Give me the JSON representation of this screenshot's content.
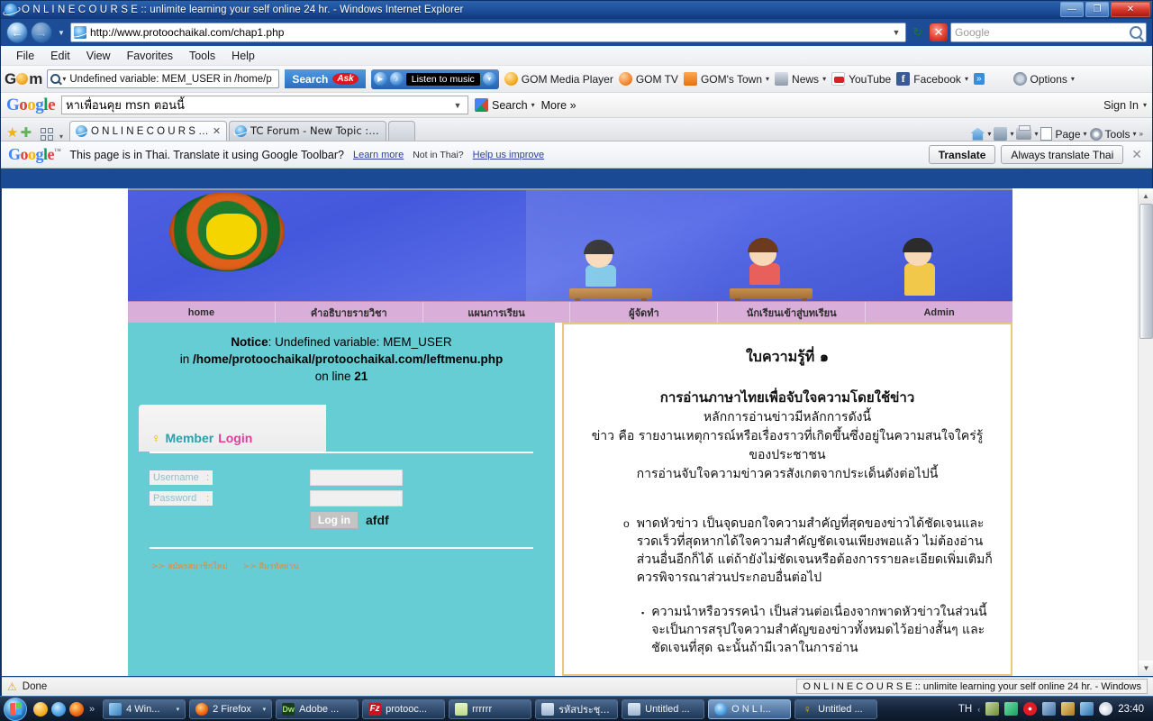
{
  "window": {
    "title": "O N L I N E C O U R S E :: unlimite learning your self online 24 hr. - Windows Internet Explorer",
    "minimize": "—",
    "maximize": "❐",
    "close": "✕"
  },
  "address_bar": {
    "back": "←",
    "forward": "→",
    "url": "http://www.protoochaikal.com/chap1.php",
    "dropdown": "▼",
    "refresh": "↻",
    "stop": "✕",
    "search_placeholder": "Google"
  },
  "menubar": {
    "items": [
      "File",
      "Edit",
      "View",
      "Favorites",
      "Tools",
      "Help"
    ]
  },
  "gom_toolbar": {
    "logo_g": "G",
    "logo_m": "m",
    "search_value": "Undefined variable: MEM_USER in /home/p",
    "search_button": "Search",
    "ask_badge": "Ask",
    "music_label": "Listen to music",
    "items": [
      {
        "label": "GOM Media Player",
        "icon": "gom-media-player-icon",
        "caret": ""
      },
      {
        "label": "GOM TV",
        "icon": "gom-tv-icon",
        "caret": ""
      },
      {
        "label": "GOM's Town",
        "icon": "rss-icon",
        "caret": "▾"
      },
      {
        "label": "News",
        "icon": "news-icon",
        "caret": "▾"
      },
      {
        "label": "YouTube",
        "icon": "youtube-icon",
        "caret": ""
      },
      {
        "label": "Facebook",
        "icon": "facebook-icon",
        "caret": "▾"
      }
    ],
    "overflow": "»",
    "options_label": "Options",
    "options_caret": "▾"
  },
  "google_toolbar": {
    "logo": [
      "G",
      "o",
      "o",
      "g",
      "l",
      "e"
    ],
    "query": "หาเพื่อนคุย msn ตอนนี้",
    "dropdown": "▼",
    "search_label": "Search",
    "search_caret": "▾",
    "more_label": "More »",
    "signin_label": "Sign In",
    "signin_caret": "▾"
  },
  "tabbar": {
    "favorites_star": "★",
    "add_favorite": "✚",
    "tabs": [
      {
        "label": "O N L I N E C O U R S E ...",
        "close": "✕",
        "active": true
      },
      {
        "label": "TC Forum - New Topic :: ร...",
        "close": "",
        "active": false
      }
    ],
    "right_items": [
      {
        "name": "home-icon",
        "label": "",
        "caret": "▾"
      },
      {
        "name": "feeds-icon",
        "label": "",
        "caret": "▾"
      },
      {
        "name": "print-icon",
        "label": "",
        "caret": "▾"
      },
      {
        "name": "page-icon",
        "label": "Page",
        "caret": "▾"
      },
      {
        "name": "tools-icon",
        "label": "Tools",
        "caret": "▾"
      }
    ],
    "overflow": "»"
  },
  "translate_bar": {
    "logo": [
      "G",
      "o",
      "o",
      "g",
      "l",
      "e"
    ],
    "tm": "™",
    "message": "This page is in Thai.  Translate it using Google Toolbar?",
    "learn_more": "Learn more",
    "not_in_thai": "Not in Thai?",
    "help_us": "Help us improve",
    "translate_button": "Translate",
    "always_button": "Always translate Thai",
    "close": "✕"
  },
  "page": {
    "nav_items": [
      "home",
      "คำอธิบายรายวิชา",
      "แผนการเรียน",
      "ผู้จัดทำ",
      "นักเรียนเข้าสู่บทเรียน",
      "Admin"
    ],
    "notice": {
      "label": "Notice",
      "line1_rest": ": Undefined variable: MEM_USER",
      "line2_prefix": "in ",
      "line2_path": "/home/protoochaikal/protoochaikal.com/leftmenu.php",
      "line3_prefix": "on line ",
      "line3_num": "21"
    },
    "login": {
      "trophy": "♀",
      "member": "Member",
      "login_word": "Login",
      "username_label": "Username",
      "username_colon": ":",
      "username_value": "",
      "password_label": "Password",
      "password_colon": ":",
      "password_value": "",
      "button": "Log in",
      "extra_text": "afdf",
      "register_link": ">> สมัครสมาชิกใหม่",
      "forgot_link": ">> ลืมรหัสผ่าน"
    },
    "content": {
      "title": "ใบความรู้ที่ ๑",
      "subtitle": "การอ่านภาษาไทยเพื่อจับใจความโดยใช้ข่าว",
      "lines": [
        "หลักการอ่านข่าวมีหลักการดังนี้",
        "ข่าว  คือ  รายงานเหตุการณ์หรือเรื่องราวที่เกิดขึ้นซึ่งอยู่ในความสนใจใคร่รู้",
        "ของประชาชน",
        "การอ่านจับใจความข่าวควรสังเกตจากประเด็นดังต่อไปนี้"
      ],
      "bullet1": {
        "marker": "o",
        "text": "พาดหัวข่าว  เป็นจุดบอกใจความสำคัญที่สุดของข่าวได้ชัดเจนและรวดเร็วที่สุดหากได้ใจความสำคัญชัดเจนเพียงพอแล้ว  ไม่ต้องอ่านส่วนอื่นอีกก็ได้ แต่ถ้ายังไม่ชัดเจนหรือต้องการรายละเอียดเพิ่มเติมก็ควรพิจารณาส่วนประกอบอื่นต่อไป"
      },
      "bullet2": {
        "marker": "▪",
        "text": "ความนำหรือวรรคนำ  เป็นส่วนต่อเนื่องจากพาดหัวข่าวในส่วนนี้จะเป็นการสรุปใจความสำคัญของข่าวทั้งหมดไว้อย่างสั้นๆ และชัดเจนที่สุด  ฉะนั้นถ้ามีเวลาในการอ่าน"
      }
    },
    "scrollbar": {
      "up": "▲",
      "down": "▼"
    }
  },
  "statusbar": {
    "text": "Done",
    "icon": "warning-icon"
  },
  "taskbar": {
    "start": "start-orb",
    "quicklaunch": [
      "gom-icon",
      "internet-explorer-icon",
      "firefox-icon"
    ],
    "quicklaunch_overflow": "»",
    "tasks": [
      {
        "label": "4 Win...",
        "icon": "win",
        "caret": "▾",
        "active": false
      },
      {
        "label": "2 Firefox",
        "icon": "fx",
        "caret": "▾",
        "active": false
      },
      {
        "label": "Adobe ...",
        "icon": "dw",
        "caret": "",
        "active": false
      },
      {
        "label": "protooc...",
        "icon": "fz",
        "caret": "",
        "active": false
      },
      {
        "label": "rrrrrr",
        "icon": "note",
        "caret": "",
        "active": false
      },
      {
        "label": "รหัสประชุ...",
        "icon": "doc",
        "caret": "",
        "active": false
      },
      {
        "label": "Untitled ...",
        "icon": "doc",
        "caret": "",
        "active": false
      },
      {
        "label": "O N L I...",
        "icon": "ie",
        "caret": "",
        "active": true
      },
      {
        "label": "Untitled ...",
        "icon": "tro",
        "caret": "",
        "active": false
      }
    ],
    "language": "TH",
    "tray_chevron": "‹",
    "clock": "23:40",
    "tooltip": "O N L I N E C O U R S E :: unlimite learning your self online 24 hr. - Windows"
  }
}
